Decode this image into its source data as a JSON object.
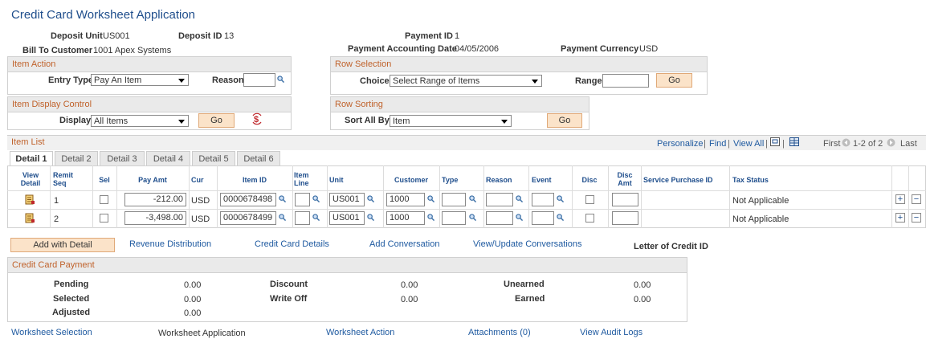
{
  "page": {
    "title": "Credit Card Worksheet Application"
  },
  "header": {
    "deposit_unit_label": "Deposit Unit",
    "deposit_unit": "US001",
    "deposit_id_label": "Deposit ID",
    "deposit_id": "13",
    "payment_id_label": "Payment ID",
    "payment_id": "1",
    "bill_to_label": "Bill To Customer",
    "bill_to": "1001 Apex Systems",
    "pay_date_label": "Payment Accounting Date",
    "pay_date": "04/05/2006",
    "pay_currency_label": "Payment Currency",
    "pay_currency": "USD"
  },
  "item_action": {
    "title": "Item Action",
    "entry_type_label": "Entry Type",
    "entry_type": "Pay An Item",
    "reason_label": "Reason",
    "reason": ""
  },
  "row_selection": {
    "title": "Row Selection",
    "choice_label": "Choice",
    "choice": "Select Range of Items",
    "range_label": "Range",
    "range": "",
    "go": "Go"
  },
  "item_display": {
    "title": "Item Display Control",
    "display_label": "Display",
    "display": "All Items",
    "go": "Go"
  },
  "row_sorting": {
    "title": "Row Sorting",
    "sort_label": "Sort All By",
    "sort": "Item",
    "go": "Go"
  },
  "item_list": {
    "title": "Item List",
    "personalize": "Personalize",
    "find": "Find",
    "view_all": "View All",
    "first": "First",
    "count": "1-2 of 2",
    "last": "Last",
    "sep1": "|",
    "sep2": "|",
    "sep3": "|",
    "tabs": [
      {
        "label": "Detail 1"
      },
      {
        "label": "Detail 2"
      },
      {
        "label": "Detail 3"
      },
      {
        "label": "Detail 4"
      },
      {
        "label": "Detail 5"
      },
      {
        "label": "Detail 6"
      }
    ],
    "columns": {
      "view_detail": "View Detail",
      "remit_seq": "Remit Seq",
      "sel": "Sel",
      "pay_amt": "Pay Amt",
      "cur": "Cur",
      "item_id": "Item ID",
      "item_line": "Item Line",
      "unit": "Unit",
      "customer": "Customer",
      "type": "Type",
      "reason": "Reason",
      "event": "Event",
      "disc": "Disc",
      "disc_amt": "Disc Amt",
      "service_purchase_id": "Service Purchase ID",
      "tax_status": "Tax Status"
    },
    "rows": [
      {
        "seq": "1",
        "pay_amt": "-212.00",
        "cur": "USD",
        "item_id": "0000678498",
        "unit": "US001",
        "customer": "1000",
        "tax_status": "Not Applicable"
      },
      {
        "seq": "2",
        "pay_amt": "-3,498.00",
        "cur": "USD",
        "item_id": "0000678499",
        "unit": "US001",
        "customer": "1000",
        "tax_status": "Not Applicable"
      }
    ]
  },
  "actions": {
    "add_detail": "Add with Detail",
    "revenue": "Revenue Distribution",
    "cc_details": "Credit Card Details",
    "add_conv": "Add Conversation",
    "view_conv": "View/Update Conversations",
    "loc_id": "Letter of Credit ID"
  },
  "cc_payment": {
    "title": "Credit Card Payment",
    "pending_label": "Pending",
    "pending": "0.00",
    "selected_label": "Selected",
    "selected": "0.00",
    "adjusted_label": "Adjusted",
    "adjusted": "0.00",
    "discount_label": "Discount",
    "discount": "0.00",
    "writeoff_label": "Write Off",
    "writeoff": "0.00",
    "unearned_label": "Unearned",
    "unearned": "0.00",
    "earned_label": "Earned",
    "earned": "0.00"
  },
  "footer": {
    "ws_selection": "Worksheet Selection",
    "ws_application": "Worksheet Application",
    "ws_action": "Worksheet Action",
    "attachments": "Attachments (0)",
    "audit": "View Audit Logs"
  },
  "colors": {
    "accent": "#1f4e8c",
    "section_title": "#c0622b",
    "button": "#fbe3c9"
  }
}
